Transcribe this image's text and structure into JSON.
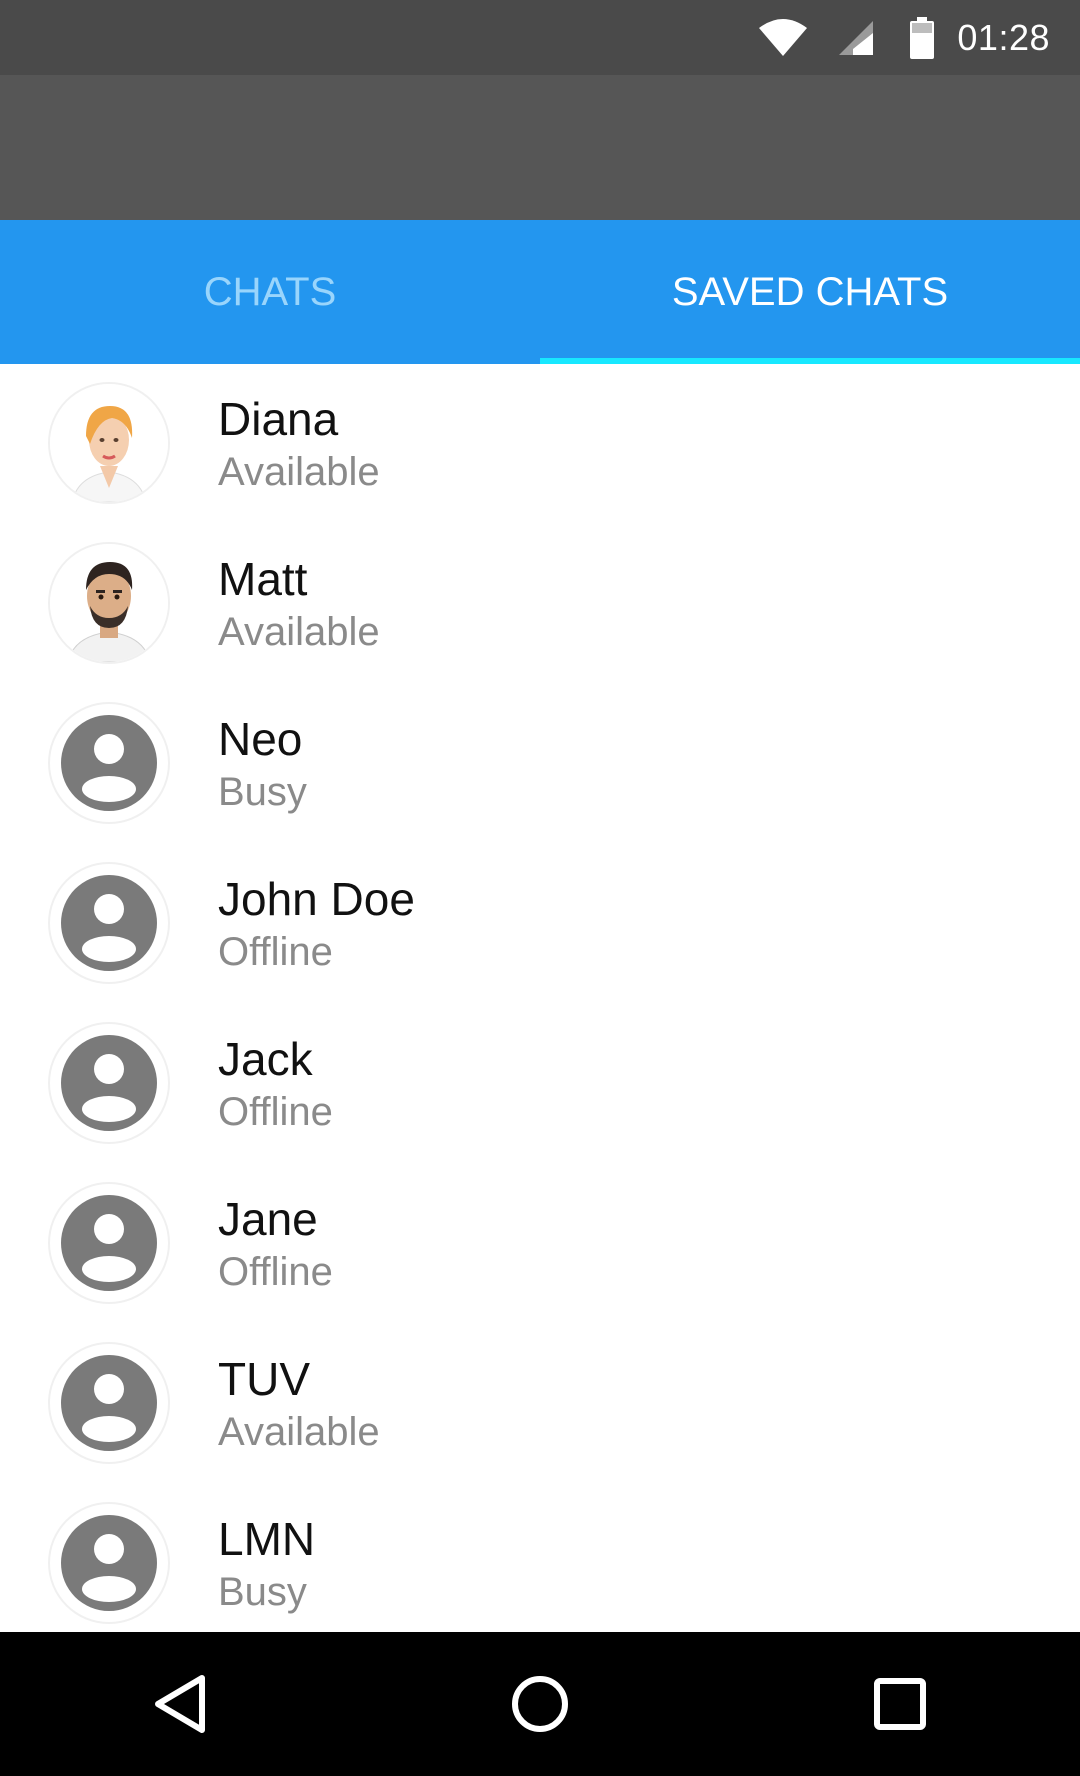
{
  "status_bar": {
    "time": "01:28"
  },
  "tabs": [
    {
      "label": "CHATS",
      "active": false
    },
    {
      "label": "SAVED CHATS",
      "active": true
    }
  ],
  "contacts": [
    {
      "name": "Diana",
      "status": "Available",
      "avatar": "photo-woman"
    },
    {
      "name": "Matt",
      "status": "Available",
      "avatar": "photo-man"
    },
    {
      "name": "Neo",
      "status": "Busy",
      "avatar": "default-person-icon"
    },
    {
      "name": "John Doe",
      "status": "Offline",
      "avatar": "default-person-icon"
    },
    {
      "name": "Jack",
      "status": "Offline",
      "avatar": "default-person-icon"
    },
    {
      "name": "Jane",
      "status": "Offline",
      "avatar": "default-person-icon"
    },
    {
      "name": "TUV",
      "status": "Available",
      "avatar": "default-person-icon"
    },
    {
      "name": "LMN",
      "status": "Busy",
      "avatar": "default-person-icon"
    }
  ],
  "colors": {
    "status_bar": "#4a4a4a",
    "app_bar": "#565656",
    "tab_bar": "#2396ef",
    "tab_indicator": "#18e8ff"
  }
}
